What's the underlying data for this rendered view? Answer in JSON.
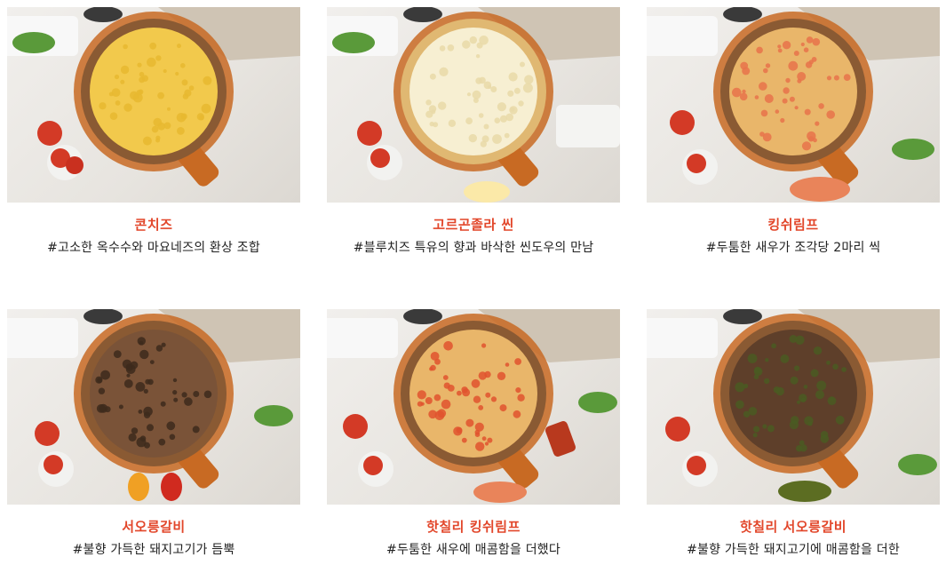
{
  "menu": {
    "items": [
      {
        "name": "콘치즈",
        "description": "#고소한 옥수수와 마요네즈의 환상 조합",
        "crust_color": "#8a5a33",
        "top_color": "#f2c94c",
        "topping_color": "#e8b830"
      },
      {
        "name": "고르곤졸라 씬",
        "description": "#블루치즈 특유의 향과 바삭한 씬도우의 만남",
        "crust_color": "#e0b872",
        "top_color": "#f7efd2",
        "topping_color": "#e9d9a8"
      },
      {
        "name": "킹쉬림프",
        "description": "#두툼한 새우가 조각당 2마리 씩",
        "crust_color": "#8a5a33",
        "top_color": "#e9b66a",
        "topping_color": "#e8734a"
      },
      {
        "name": "서오릉갈비",
        "description": "#불향 가득한 돼지고기가 듬뿍",
        "crust_color": "#8a5a33",
        "top_color": "#7a5338",
        "topping_color": "#3d2a1c"
      },
      {
        "name": "핫칠리 킹쉬림프",
        "description": "#두툼한 새우에 매콤함을 더했다",
        "crust_color": "#8a5a33",
        "top_color": "#e9b66a",
        "topping_color": "#e0532e"
      },
      {
        "name": "핫칠리 서오릉갈비",
        "description": "#불향 가득한 돼지고기에 매콤함을 더한",
        "crust_color": "#8a5a33",
        "top_color": "#5e3f2a",
        "topping_color": "#4a5a22"
      }
    ]
  }
}
